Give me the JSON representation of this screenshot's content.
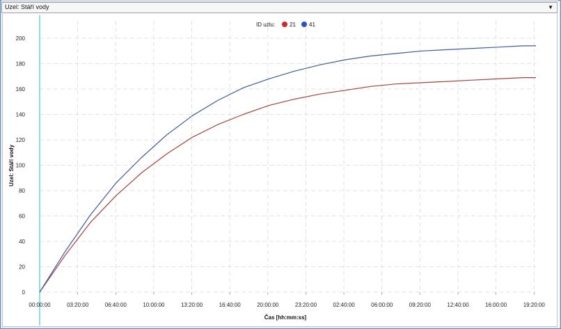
{
  "selector": {
    "value": "Uzel: Stáří vody",
    "arrow": "▼"
  },
  "legend": {
    "title": "ID uzlu:"
  },
  "colors": {
    "series_21": "#cc2a2a",
    "series_41": "#2b52c9",
    "line_21": "#a4413e",
    "line_41": "#3d5a9c",
    "grid": "#d9d9d9",
    "cursor": "#43c4cf"
  },
  "chart_data": {
    "type": "line",
    "xlabel": "Čas [hh:mm:ss]",
    "ylabel": "Uzel: Stáří vody",
    "ylim": [
      0,
      200
    ],
    "xlim_hours": [
      0,
      19.5
    ],
    "x_tick_labels": [
      "00:00:00",
      "03:20:00",
      "06:40:00",
      "10:00:00",
      "13:20:00",
      "16:40:00",
      "20:00:00",
      "23:20:00",
      "02:40:00",
      "06:00:00",
      "09:20:00",
      "12:40:00",
      "16:00:00",
      "19:20:00"
    ],
    "y_ticks": [
      0,
      20,
      40,
      60,
      80,
      100,
      120,
      140,
      160,
      180,
      200
    ],
    "grid": true,
    "legend_position": "top-center",
    "series": [
      {
        "name": "21",
        "x_hours": [
          0,
          1,
          2,
          3,
          4,
          5,
          6,
          7,
          8,
          9,
          10,
          11,
          12,
          13,
          14,
          15,
          16,
          17,
          18,
          19,
          19.5
        ],
        "values": [
          0,
          29,
          55,
          76,
          94,
          109,
          122,
          132,
          140,
          147,
          152,
          156,
          159,
          162,
          164,
          165,
          166,
          167,
          168,
          169,
          169
        ]
      },
      {
        "name": "41",
        "x_hours": [
          0,
          1,
          2,
          3,
          4,
          5,
          6,
          7,
          8,
          9,
          10,
          11,
          12,
          13,
          14,
          15,
          16,
          17,
          18,
          19,
          19.5
        ],
        "values": [
          0,
          32,
          61,
          86,
          106,
          124,
          139,
          151,
          161,
          168,
          174,
          179,
          183,
          186,
          188,
          190,
          191,
          192,
          193,
          194,
          194
        ]
      }
    ]
  }
}
